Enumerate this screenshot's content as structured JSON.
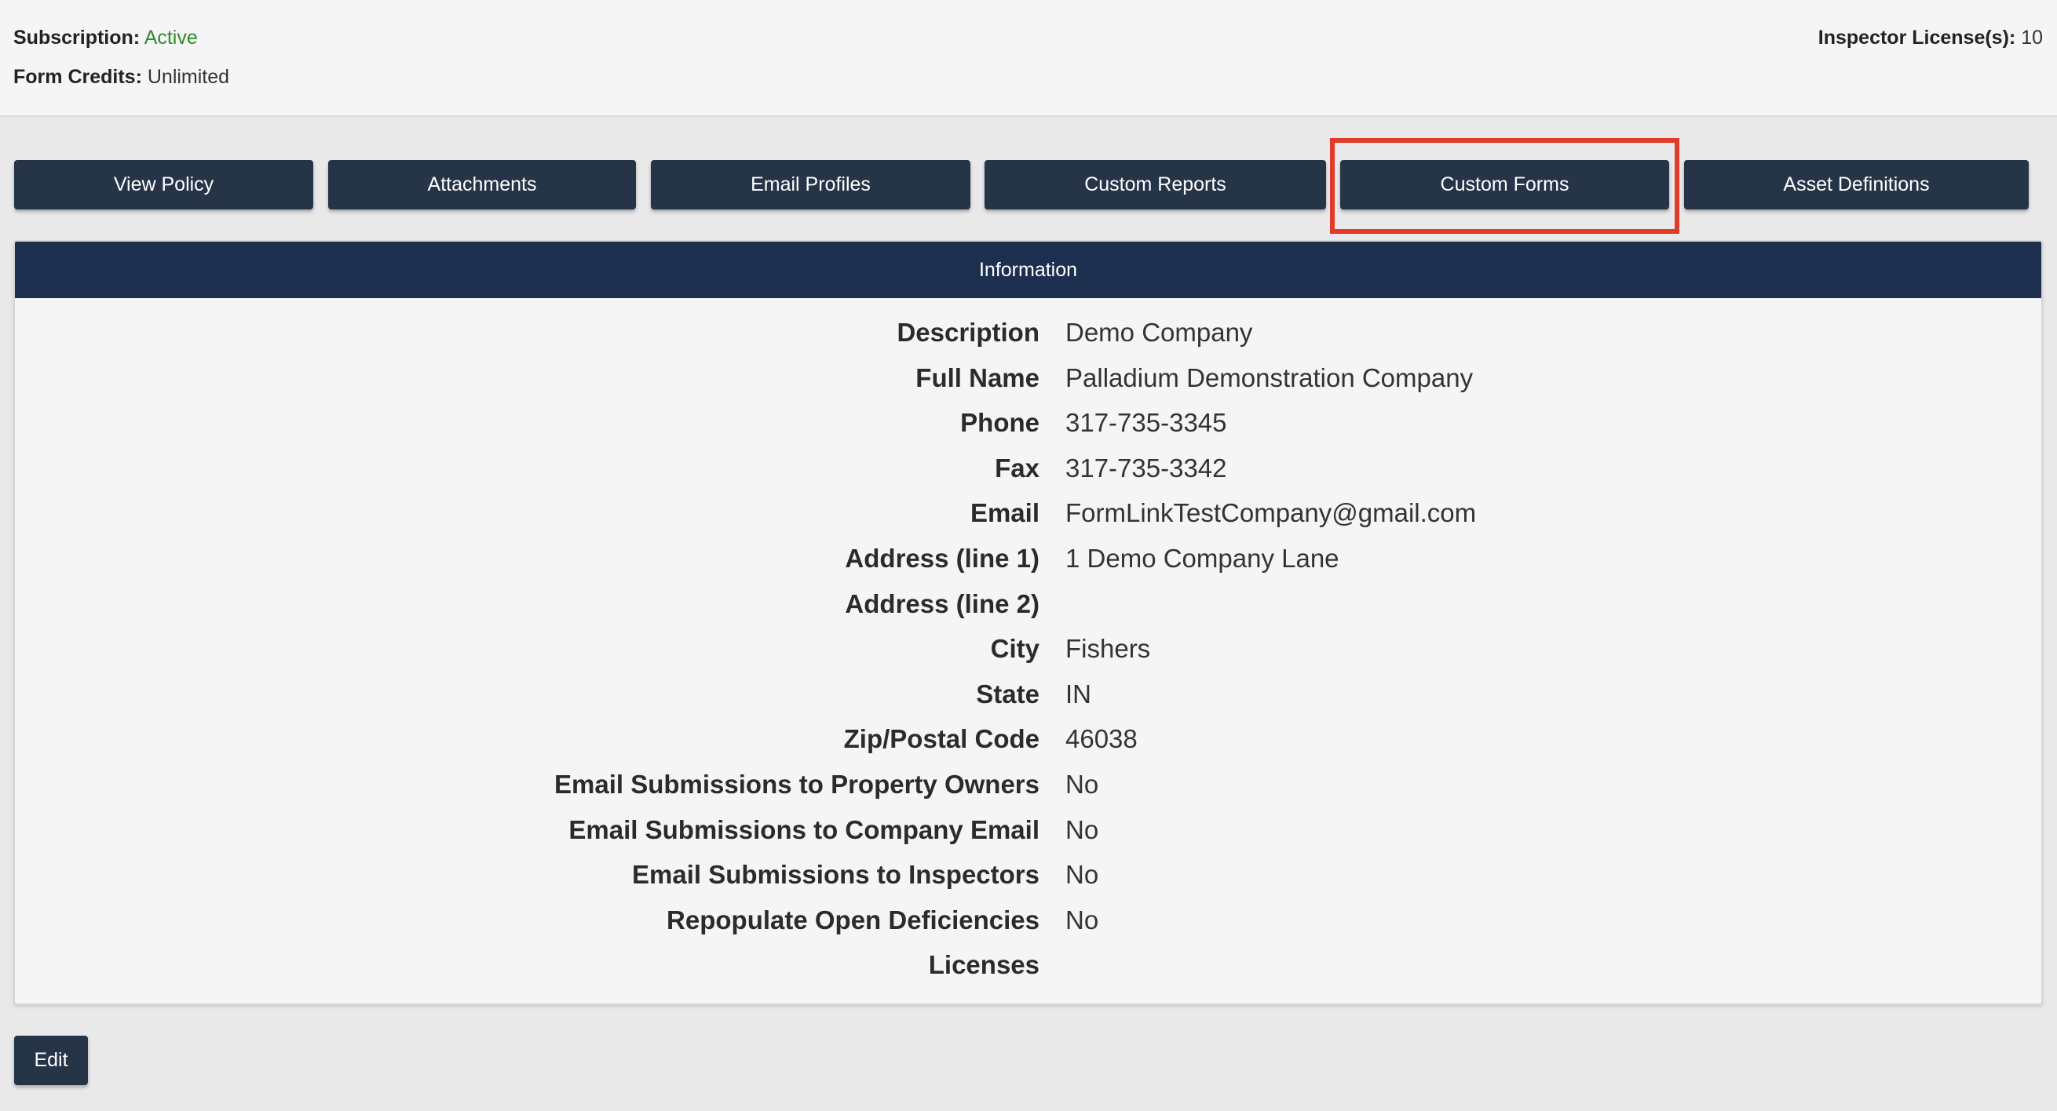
{
  "account": {
    "subscription_label": "Subscription:",
    "subscription_value": "Active",
    "form_credits_label": "Form Credits:",
    "form_credits_value": "Unlimited",
    "license_label": "Inspector License(s):",
    "license_value": "10"
  },
  "toolbar": {
    "buttons": [
      {
        "label": "View Policy"
      },
      {
        "label": "Attachments"
      },
      {
        "label": "Email Profiles"
      },
      {
        "label": "Custom Reports"
      },
      {
        "label": "Custom Forms"
      },
      {
        "label": "Asset Definitions"
      }
    ]
  },
  "highlight": {
    "target": "Custom Forms",
    "color": "#e23a28"
  },
  "info": {
    "title": "Information",
    "rows": [
      {
        "label": "Description",
        "value": "Demo Company"
      },
      {
        "label": "Full Name",
        "value": "Palladium Demonstration Company"
      },
      {
        "label": "Phone",
        "value": "317-735-3345"
      },
      {
        "label": "Fax",
        "value": "317-735-3342"
      },
      {
        "label": "Email",
        "value": "FormLinkTestCompany@gmail.com"
      },
      {
        "label": "Address (line 1)",
        "value": "1 Demo Company Lane"
      },
      {
        "label": "Address (line 2)",
        "value": ""
      },
      {
        "label": "City",
        "value": "Fishers"
      },
      {
        "label": "State",
        "value": "IN"
      },
      {
        "label": "Zip/Postal Code",
        "value": "46038"
      },
      {
        "label": "Email Submissions to Property Owners",
        "value": "No"
      },
      {
        "label": "Email Submissions to Company Email",
        "value": "No"
      },
      {
        "label": "Email Submissions to Inspectors",
        "value": "No"
      },
      {
        "label": "Repopulate Open Deficiencies",
        "value": "No"
      },
      {
        "label": "Licenses",
        "value": ""
      }
    ]
  },
  "actions": {
    "edit_label": "Edit"
  },
  "colors": {
    "button_bg": "#263448",
    "header_bg": "#1c2f4f",
    "active_green": "#2e8b2e"
  }
}
